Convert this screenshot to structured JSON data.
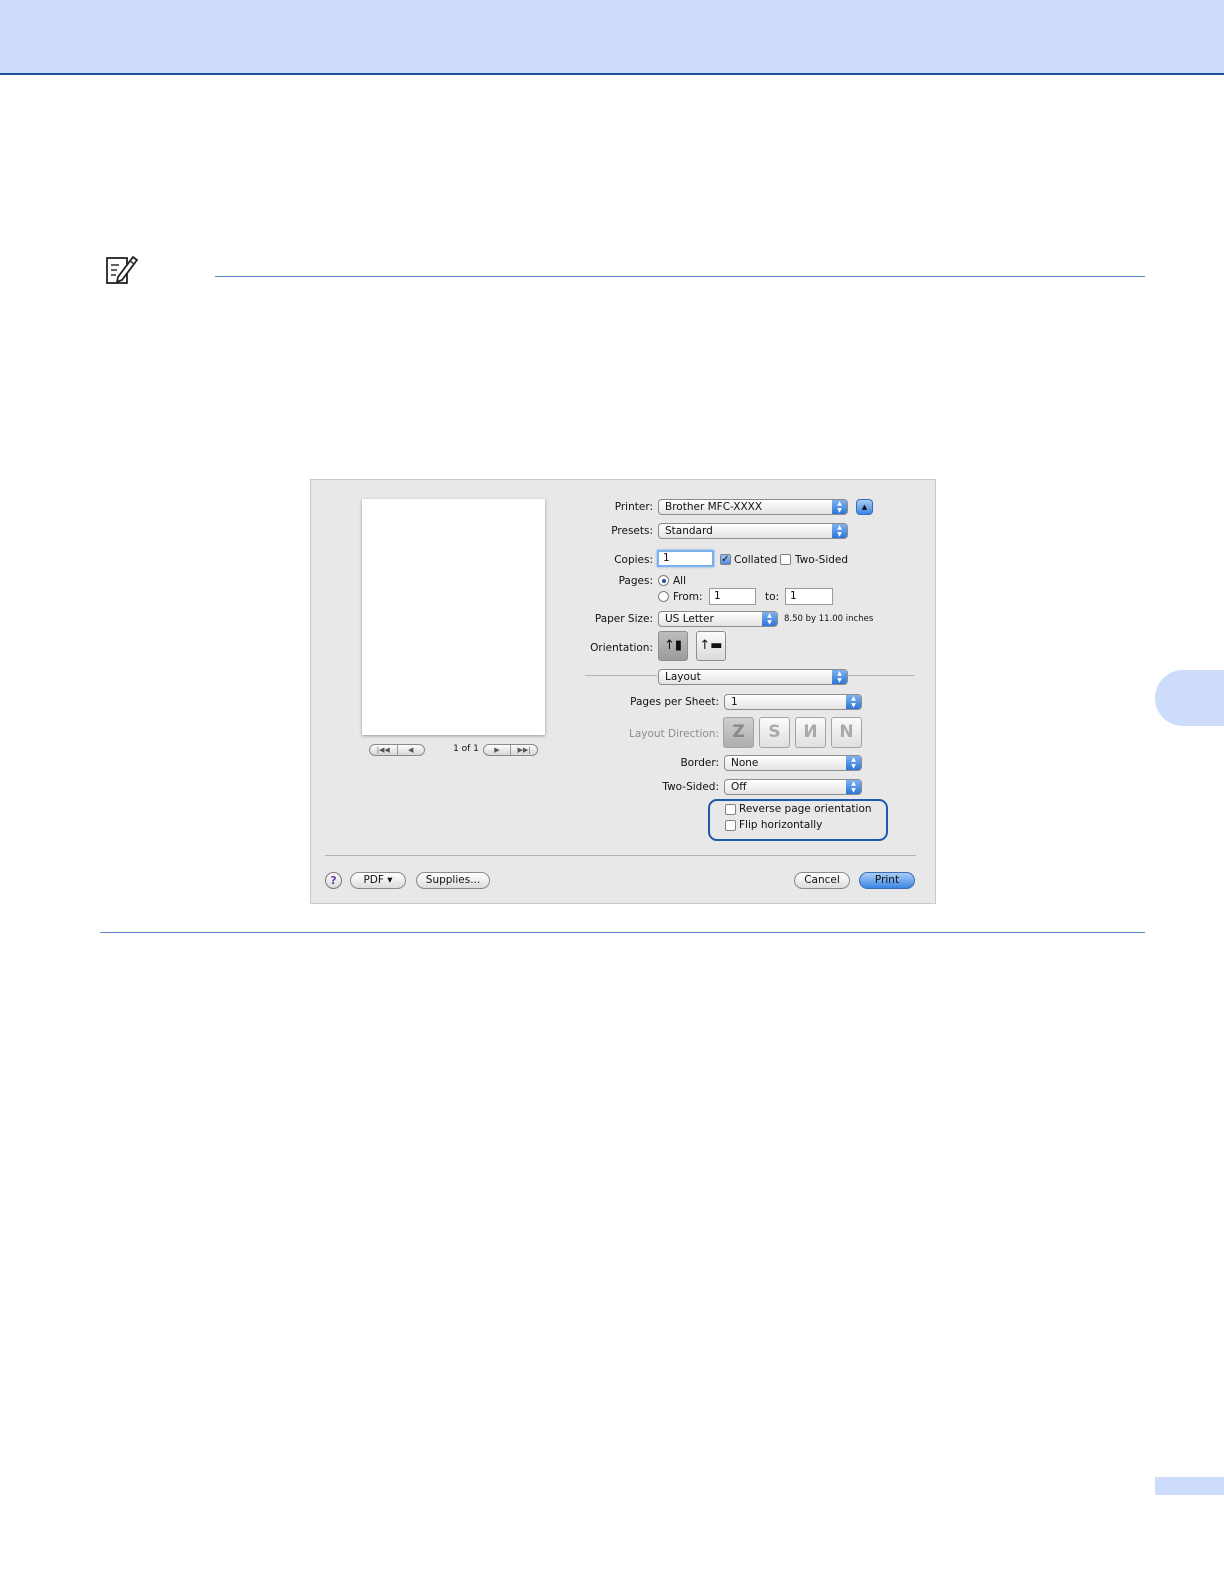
{
  "dialog": {
    "printer_label": "Printer:",
    "printer_value": "Brother MFC-XXXX",
    "presets_label": "Presets:",
    "presets_value": "Standard",
    "copies_label": "Copies:",
    "copies_value": "1",
    "collated_label": "Collated",
    "collated_checked": true,
    "two_sided_check_label": "Two-Sided",
    "pages_label": "Pages:",
    "pages_all": "All",
    "pages_from": "From:",
    "from_value": "1",
    "pages_to": "to:",
    "to_value": "1",
    "paper_size_label": "Paper Size:",
    "paper_size_value": "US Letter",
    "paper_size_dims": "8.50 by 11.00 inches",
    "orientation_label": "Orientation:",
    "section_value": "Layout",
    "pages_per_sheet_label": "Pages per Sheet:",
    "pages_per_sheet_value": "1",
    "layout_direction_label": "Layout Direction:",
    "border_label": "Border:",
    "border_value": "None",
    "two_sided_label": "Two-Sided:",
    "two_sided_value": "Off",
    "reverse_label": "Reverse page orientation",
    "flip_label": "Flip horizontally",
    "page_count": "1 of 1",
    "pdf_button": "PDF ▾",
    "supplies_button": "Supplies...",
    "cancel_button": "Cancel",
    "print_button": "Print",
    "help_glyph": "?"
  },
  "icons": {
    "note": "note-pencil-icon",
    "portrait": "portrait-orientation-icon",
    "landscape": "landscape-orientation-icon",
    "layout_directions": [
      "Z",
      "S",
      "И",
      "N"
    ]
  },
  "colors": {
    "header_band": "#cddcfb",
    "rule": "#5b87d0",
    "highlight": "#1f5aa8"
  }
}
